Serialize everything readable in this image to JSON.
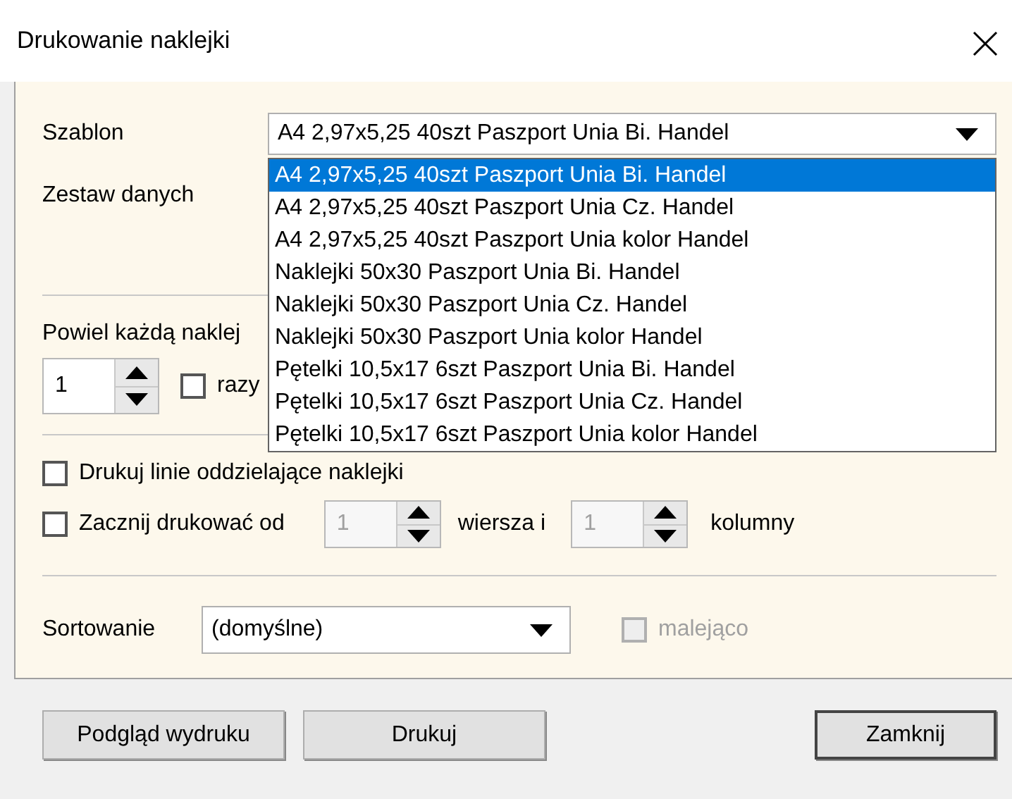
{
  "window": {
    "title": "Drukowanie naklejki"
  },
  "template": {
    "label": "Szablon",
    "value": "A4 2,97x5,25 40szt Paszport Unia Bi. Handel",
    "expanded": true,
    "options": [
      {
        "label": "A4 2,97x5,25 40szt Paszport Unia Bi. Handel",
        "selected": true
      },
      {
        "label": "A4 2,97x5,25 40szt Paszport Unia Cz. Handel",
        "selected": false
      },
      {
        "label": "A4 2,97x5,25 40szt Paszport Unia kolor Handel",
        "selected": false
      },
      {
        "label": "Naklejki 50x30 Paszport Unia Bi. Handel",
        "selected": false
      },
      {
        "label": "Naklejki 50x30 Paszport Unia Cz. Handel",
        "selected": false
      },
      {
        "label": "Naklejki 50x30 Paszport Unia kolor Handel",
        "selected": false
      },
      {
        "label": "Pętelki 10,5x17 6szt Paszport Unia Bi. Handel",
        "selected": false
      },
      {
        "label": "Pętelki 10,5x17 6szt Paszport Unia Cz. Handel",
        "selected": false
      },
      {
        "label": "Pętelki 10,5x17 6szt Paszport Unia kolor Handel",
        "selected": false
      }
    ]
  },
  "data_set": {
    "label": "Zestaw danych"
  },
  "copies": {
    "label": "Powiel każdą naklej",
    "value": "1",
    "disabled": false,
    "checkbox": {
      "label": "razy",
      "checked": false
    }
  },
  "options": [
    {
      "kind": "checkbox",
      "label": "Drukuj linie oddzielające naklejki",
      "checked": false
    },
    {
      "kind": "start",
      "label": "Zacznij drukować od",
      "checked": false,
      "row": {
        "value": "1",
        "disabled": true
      },
      "row_label": "wiersza i",
      "column": {
        "value": "1",
        "disabled": true
      },
      "column_label": "kolumny"
    }
  ],
  "sorting": {
    "label": "Sortowanie",
    "value": "(domyślne)",
    "descending": {
      "label": "malejąco",
      "checked": false,
      "disabled": true
    }
  },
  "buttons": [
    {
      "label": "Podgląd wydruku",
      "default": false
    },
    {
      "label": "Drukuj",
      "default": false
    },
    {
      "label": "Zamknij",
      "default": true
    }
  ]
}
